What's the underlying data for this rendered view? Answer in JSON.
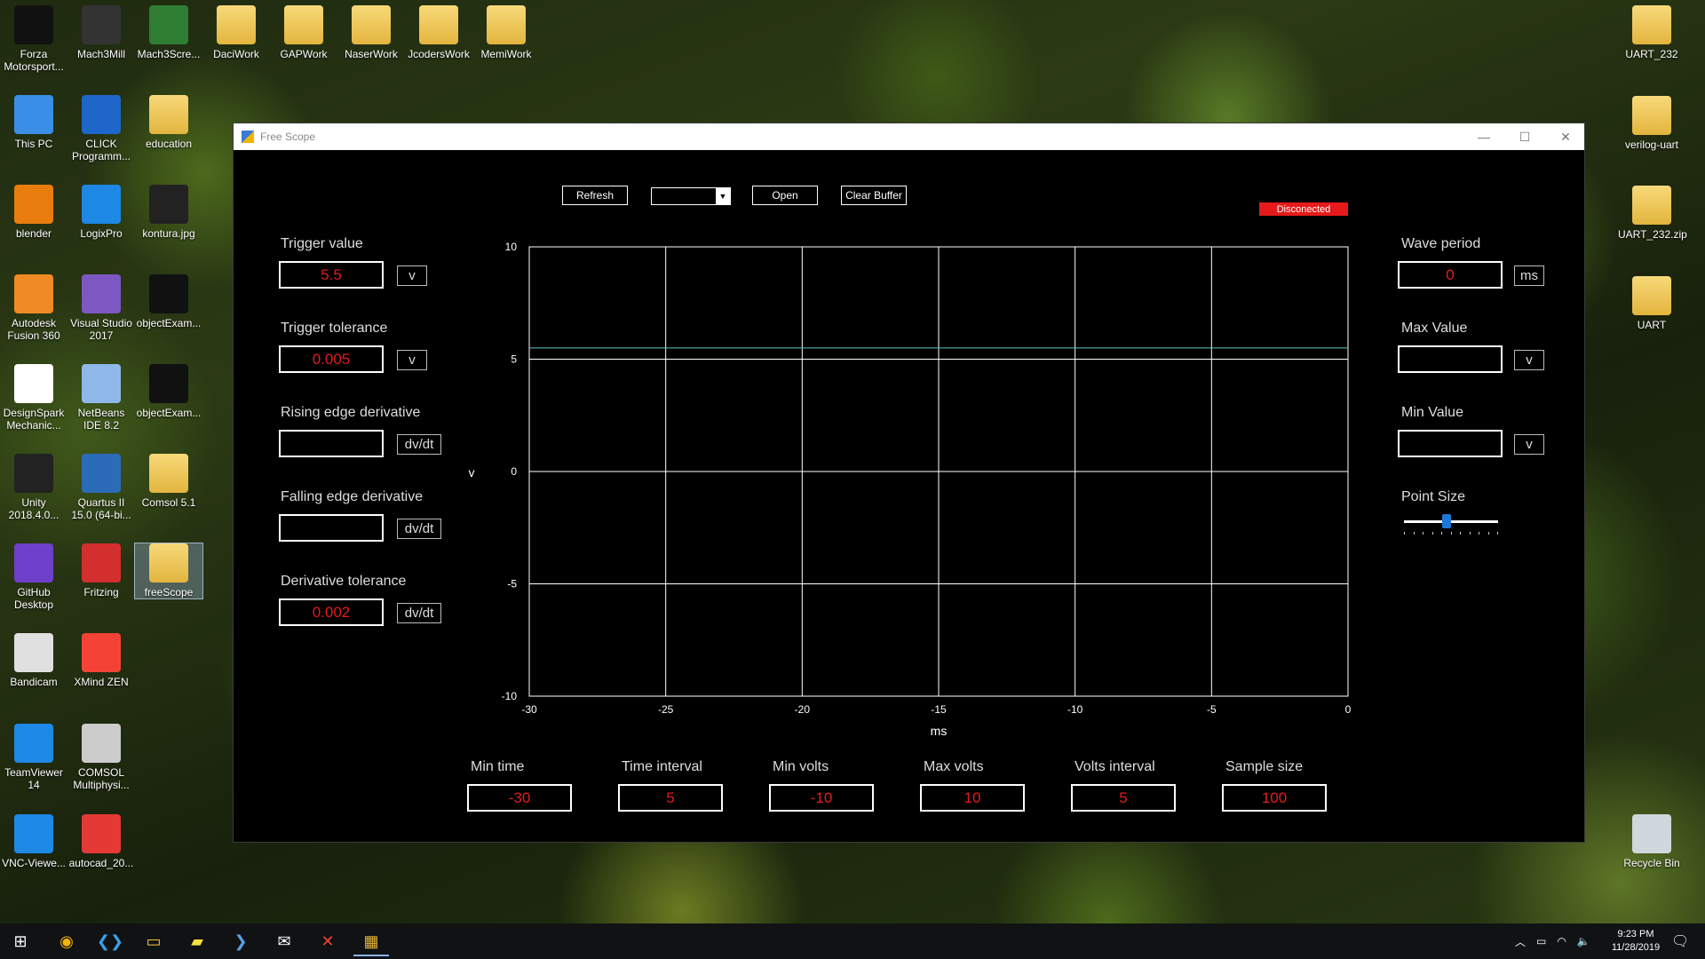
{
  "desktop": {
    "icons_left": [
      {
        "label": "Forza Motorsport...",
        "icon": "forza-icon",
        "color": "#111111"
      },
      {
        "label": "Mach3Mill",
        "icon": "mach3-icon",
        "color": "#333333"
      },
      {
        "label": "Mach3Scre...",
        "icon": "mach3screen-icon",
        "color": "#2e7d32"
      },
      {
        "label": "DaciWork",
        "icon": "folder-icon",
        "color": "#e8c050"
      },
      {
        "label": "GAPWork",
        "icon": "pdf-folder-icon",
        "color": "#e8c050"
      },
      {
        "label": "NaserWork",
        "icon": "folder-icon",
        "color": "#e8c050"
      },
      {
        "label": "JcodersWork",
        "icon": "folder-icon",
        "color": "#e8c050"
      },
      {
        "label": "MemiWork",
        "icon": "folder-icon",
        "color": "#e8c050"
      },
      {
        "label": "This PC",
        "icon": "computer-icon",
        "color": "#3a8ee6"
      },
      {
        "label": "CLICK Programm...",
        "icon": "click-icon",
        "color": "#1e66c8"
      },
      {
        "label": "education",
        "icon": "folder-icon",
        "color": "#e8c050"
      },
      {
        "label": "blender",
        "icon": "blender-icon",
        "color": "#e87d0d"
      },
      {
        "label": "LogixPro",
        "icon": "logixpro-icon",
        "color": "#1e88e5"
      },
      {
        "label": "kontura.jpg",
        "icon": "image-icon",
        "color": "#222222"
      },
      {
        "label": "Autodesk Fusion 360",
        "icon": "fusion-icon",
        "color": "#f08a24"
      },
      {
        "label": "Visual Studio 2017",
        "icon": "visual-studio-icon",
        "color": "#7e57c2"
      },
      {
        "label": "objectExam...",
        "icon": "image-icon",
        "color": "#111111"
      },
      {
        "label": "DesignSpark Mechanic...",
        "icon": "designspark-icon",
        "color": "#ffffff"
      },
      {
        "label": "NetBeans IDE 8.2",
        "icon": "netbeans-icon",
        "color": "#8fb8e8"
      },
      {
        "label": "objectExam...",
        "icon": "image-icon",
        "color": "#111111"
      },
      {
        "label": "Unity 2018.4.0...",
        "icon": "unity-icon",
        "color": "#222222"
      },
      {
        "label": "Quartus II 15.0 (64-bi...",
        "icon": "quartus-icon",
        "color": "#2c6bb8"
      },
      {
        "label": "Comsol 5.1",
        "icon": "folder-icon",
        "color": "#e8c050"
      },
      {
        "label": "GitHub Desktop",
        "icon": "github-icon",
        "color": "#6e40c9"
      },
      {
        "label": "Fritzing",
        "icon": "fritzing-icon",
        "color": "#d32f2f"
      },
      {
        "label": "freeScope",
        "icon": "folder-icon",
        "color": "#e8c050"
      },
      {
        "label": "Bandicam",
        "icon": "bandicam-icon",
        "color": "#e0e0e0"
      },
      {
        "label": "XMind ZEN",
        "icon": "xmind-icon",
        "color": "#f44336"
      },
      {
        "label": "TeamViewer 14",
        "icon": "teamviewer-icon",
        "color": "#1e88e5"
      },
      {
        "label": "COMSOL Multiphysi...",
        "icon": "comsol-icon",
        "color": "#cccccc"
      },
      {
        "label": "VNC-Viewe...",
        "icon": "vnc-icon",
        "color": "#1e88e5"
      },
      {
        "label": "autocad_20...",
        "icon": "pdf-icon",
        "color": "#e53935"
      }
    ],
    "icons_right": [
      {
        "label": "UART_232",
        "icon": "folder-icon",
        "color": "#e8c050"
      },
      {
        "label": "verilog-uart",
        "icon": "folder-icon",
        "color": "#e8c050"
      },
      {
        "label": "UART_232.zip",
        "icon": "zip-folder-icon",
        "color": "#e8c050"
      },
      {
        "label": "UART",
        "icon": "folder-icon",
        "color": "#e8c050"
      },
      {
        "label": "Recycle Bin",
        "icon": "recycle-bin-icon",
        "color": "#cfd8dc"
      }
    ]
  },
  "window": {
    "title": "Free Scope",
    "minimize": "—",
    "maximize": "☐",
    "close": "✕"
  },
  "toolbar": {
    "refresh": "Refresh",
    "port_value": "",
    "open": "Open",
    "clear_buffer": "Clear Buffer"
  },
  "status": {
    "text": "Disconected",
    "color": "#e61a1a"
  },
  "left_panel": {
    "trigger_value": {
      "label": "Trigger value",
      "value": "5.5",
      "unit": "v"
    },
    "trigger_tolerance": {
      "label": "Trigger tolerance",
      "value": "0.005",
      "unit": "v"
    },
    "rising_edge": {
      "label": "Rising edge derivative",
      "value": "",
      "unit": "dv/dt"
    },
    "falling_edge": {
      "label": "Falling edge derivative",
      "value": "",
      "unit": "dv/dt"
    },
    "derivative_tolerance": {
      "label": "Derivative tolerance",
      "value": "0.002",
      "unit": "dv/dt"
    }
  },
  "right_panel": {
    "wave_period": {
      "label": "Wave period",
      "value": "0",
      "unit": "ms"
    },
    "max_value": {
      "label": "Max Value",
      "value": "",
      "unit": "v"
    },
    "min_value": {
      "label": "Min Value",
      "value": "",
      "unit": "v"
    },
    "point_size": {
      "label": "Point Size",
      "level": 0.45
    }
  },
  "bottom_panel": [
    {
      "label": "Min time",
      "value": "-30"
    },
    {
      "label": "Time interval",
      "value": "5"
    },
    {
      "label": "Min volts",
      "value": "-10"
    },
    {
      "label": "Max volts",
      "value": "10"
    },
    {
      "label": "Volts interval",
      "value": "5"
    },
    {
      "label": "Sample size",
      "value": "100"
    }
  ],
  "chart_data": {
    "type": "line",
    "xlabel": "ms",
    "ylabel": "v",
    "xlim": [
      -30,
      0
    ],
    "ylim": [
      -10,
      10
    ],
    "x_ticks": [
      -30,
      -25,
      -20,
      -15,
      -10,
      -5,
      0
    ],
    "y_ticks": [
      -10,
      -5,
      0,
      5,
      10
    ],
    "grid": true,
    "series": [
      {
        "values": [
          5.5,
          5.5
        ],
        "x": [
          -30,
          0
        ],
        "color": "#5fc6c6"
      }
    ]
  },
  "taskbar": {
    "apps": [
      {
        "icon": "windows-start-icon"
      },
      {
        "icon": "chrome-icon"
      },
      {
        "icon": "vscode-icon"
      },
      {
        "icon": "file-explorer-icon"
      },
      {
        "icon": "sticky-notes-icon"
      },
      {
        "icon": "powershell-icon"
      },
      {
        "icon": "mail-icon"
      },
      {
        "icon": "xmind-icon"
      },
      {
        "icon": "free-scope-app-icon"
      }
    ],
    "time": "9:23 PM",
    "date": "11/28/2019"
  }
}
